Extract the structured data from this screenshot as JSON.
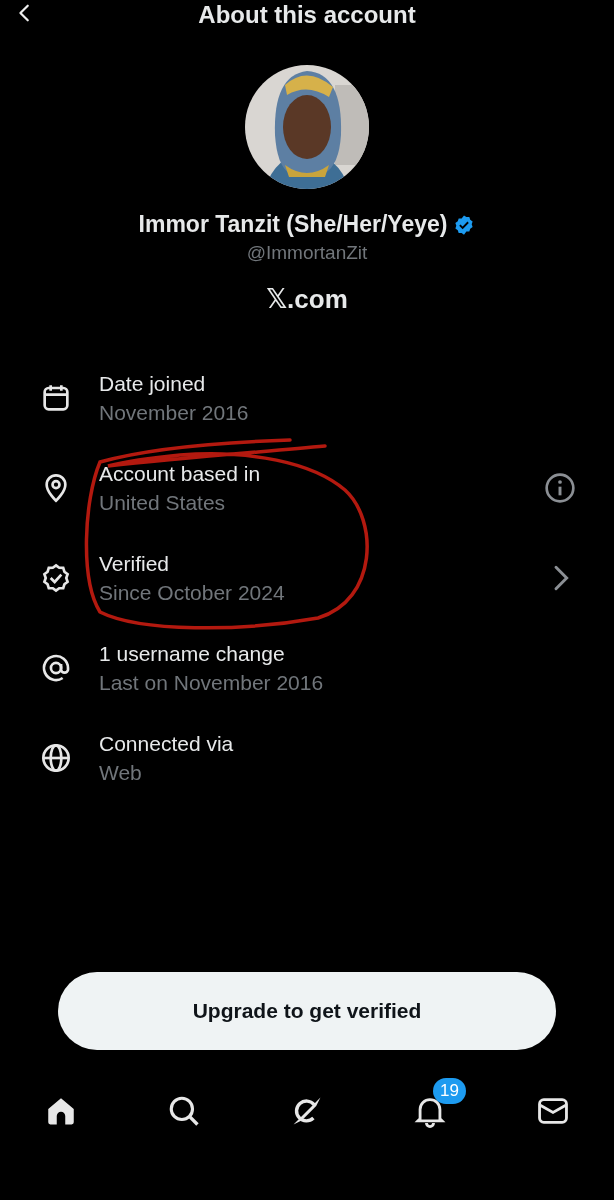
{
  "header": {
    "title": "About this account"
  },
  "profile": {
    "name": "Immor Tanzit (She/Her/Yeye)",
    "verified": true,
    "handle": "@ImmortanZit",
    "site": "𝕏.com"
  },
  "details": [
    {
      "kind": "plain",
      "label": "Date joined",
      "value": "November 2016"
    },
    {
      "kind": "info",
      "label": "Account based in",
      "value": "United States"
    },
    {
      "kind": "link",
      "label": "Verified",
      "value": "Since October 2024"
    },
    {
      "kind": "plain",
      "label": "1 username change",
      "value": "Last on November 2016"
    },
    {
      "kind": "plain",
      "label": "Connected via",
      "value": "Web"
    }
  ],
  "upgrade_button": {
    "label": "Upgrade to get verified"
  },
  "tab_bar": [
    {
      "kind": "home",
      "selected": true
    },
    {
      "kind": "search",
      "selected": false
    },
    {
      "kind": "grok",
      "selected": false
    },
    {
      "kind": "notifications",
      "selected": false,
      "badge": "19"
    },
    {
      "kind": "messages",
      "selected": false
    }
  ]
}
